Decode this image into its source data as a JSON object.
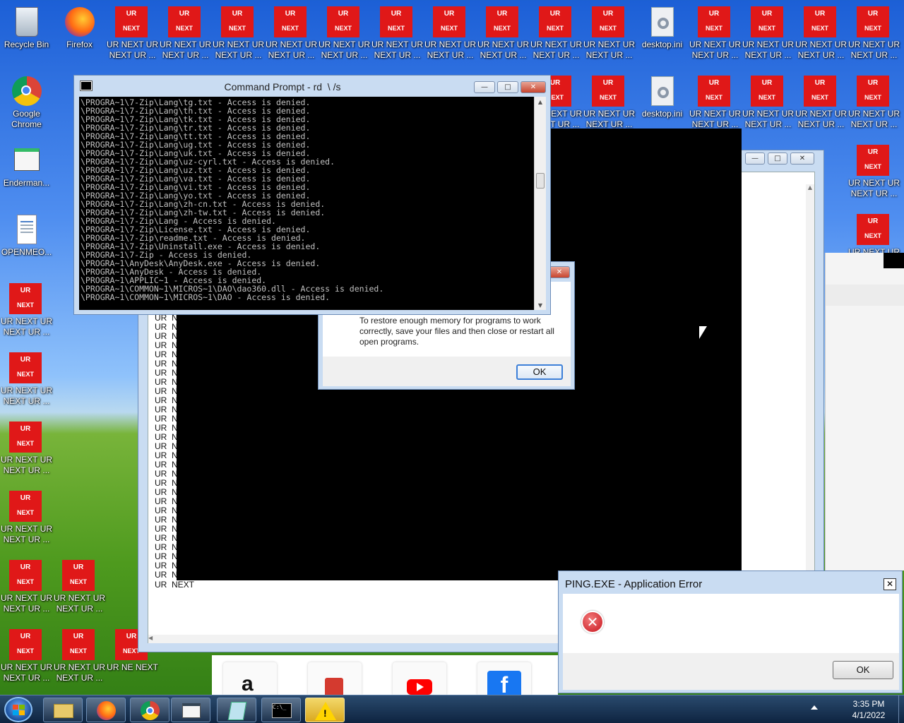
{
  "desktop": {
    "icons_row1": [
      {
        "label": "Recycle Bin",
        "kind": "recycle"
      },
      {
        "label": "Firefox",
        "kind": "firefox"
      },
      {
        "label": "UR NEXT UR NEXT UR ...",
        "kind": "ur"
      },
      {
        "label": "UR NEXT UR NEXT UR ...",
        "kind": "ur"
      },
      {
        "label": "UR NEXT UR NEXT UR ...",
        "kind": "ur"
      },
      {
        "label": "UR NEXT UR NEXT UR ...",
        "kind": "ur"
      },
      {
        "label": "UR NEXT UR NEXT UR ...",
        "kind": "ur"
      },
      {
        "label": "UR NEXT UR NEXT UR ...",
        "kind": "ur"
      },
      {
        "label": "UR NEXT UR NEXT UR ...",
        "kind": "ur"
      },
      {
        "label": "UR NEXT UR NEXT UR ...",
        "kind": "ur"
      },
      {
        "label": "UR NEXT UR NEXT UR ...",
        "kind": "ur"
      },
      {
        "label": "UR NEXT UR NEXT UR ...",
        "kind": "ur"
      },
      {
        "label": "desktop.ini",
        "kind": "ini"
      },
      {
        "label": "UR NEXT UR NEXT UR ...",
        "kind": "ur"
      },
      {
        "label": "UR NEXT UR NEXT UR ...",
        "kind": "ur"
      },
      {
        "label": "UR NEXT UR NEXT UR ...",
        "kind": "ur"
      },
      {
        "label": "UR NEXT UR NEXT UR ...",
        "kind": "ur"
      }
    ],
    "icons_row2": [
      {
        "label": "UR NEXT UR NEXT UR ...",
        "kind": "ur"
      },
      {
        "label": "UR NEXT UR NEXT UR ...",
        "kind": "ur"
      },
      {
        "label": "desktop.ini",
        "kind": "ini"
      },
      {
        "label": "UR NEXT UR NEXT UR ...",
        "kind": "ur"
      },
      {
        "label": "UR NEXT UR NEXT UR ...",
        "kind": "ur"
      },
      {
        "label": "UR NEXT UR NEXT UR ...",
        "kind": "ur"
      },
      {
        "label": "UR NEXT UR NEXT UR ...",
        "kind": "ur"
      }
    ],
    "icons_left": [
      {
        "label": "Google Chrome",
        "kind": "chrome"
      },
      {
        "label": "Enderman...",
        "kind": "app"
      },
      {
        "label": "OPENMEO...",
        "kind": "doc"
      },
      {
        "label": "UR NEXT UR NEXT UR ...",
        "kind": "ur"
      },
      {
        "label": "UR NEXT UR NEXT UR ...",
        "kind": "ur"
      },
      {
        "label": "UR NEXT UR NEXT UR ...",
        "kind": "ur"
      },
      {
        "label": "UR NEXT UR NEXT UR ...",
        "kind": "ur"
      },
      {
        "label": "UR NEXT UR NEXT UR ...",
        "kind": "ur"
      },
      {
        "label": "UR NEXT UR NEXT UR ...",
        "kind": "ur"
      }
    ],
    "icons_left_col2": [
      {
        "label": "UR NEXT UR NEXT UR ...",
        "kind": "ur"
      },
      {
        "label": "UR NEXT UR NEXT UR ...",
        "kind": "ur"
      },
      {
        "label": "UR NE NEXT",
        "kind": "ur"
      }
    ],
    "icons_right": [
      {
        "label": "UR NEXT UR NEXT UR ...",
        "kind": "ur"
      },
      {
        "label": "UR NEXT UR",
        "kind": "ur"
      }
    ],
    "tile_top": "UR",
    "tile_bottom": "NEXT"
  },
  "cmd": {
    "title": "Command Prompt - rd  \\ /s",
    "lines": [
      "\\PROGRA~1\\7-Zip\\Lang\\tg.txt - Access is denied.",
      "\\PROGRA~1\\7-Zip\\Lang\\th.txt - Access is denied.",
      "\\PROGRA~1\\7-Zip\\Lang\\tk.txt - Access is denied.",
      "\\PROGRA~1\\7-Zip\\Lang\\tr.txt - Access is denied.",
      "\\PROGRA~1\\7-Zip\\Lang\\tt.txt - Access is denied.",
      "\\PROGRA~1\\7-Zip\\Lang\\ug.txt - Access is denied.",
      "\\PROGRA~1\\7-Zip\\Lang\\uk.txt - Access is denied.",
      "\\PROGRA~1\\7-Zip\\Lang\\uz-cyrl.txt - Access is denied.",
      "\\PROGRA~1\\7-Zip\\Lang\\uz.txt - Access is denied.",
      "\\PROGRA~1\\7-Zip\\Lang\\va.txt - Access is denied.",
      "\\PROGRA~1\\7-Zip\\Lang\\vi.txt - Access is denied.",
      "\\PROGRA~1\\7-Zip\\Lang\\yo.txt - Access is denied.",
      "\\PROGRA~1\\7-Zip\\Lang\\zh-cn.txt - Access is denied.",
      "\\PROGRA~1\\7-Zip\\Lang\\zh-tw.txt - Access is denied.",
      "\\PROGRA~1\\7-Zip\\Lang - Access is denied.",
      "\\PROGRA~1\\7-Zip\\License.txt - Access is denied.",
      "\\PROGRA~1\\7-Zip\\readme.txt - Access is denied.",
      "\\PROGRA~1\\7-Zip\\Uninstall.exe - Access is denied.",
      "\\PROGRA~1\\7-Zip - Access is denied.",
      "\\PROGRA~1\\AnyDesk\\AnyDesk.exe - Access is denied.",
      "\\PROGRA~1\\AnyDesk - Access is denied.",
      "\\PROGRA~1\\APPLIC~1 - Access is denied.",
      "\\PROGRA~1\\COMMON~1\\MICROS~1\\DAO\\dao360.dll - Access is denied.",
      "\\PROGRA~1\\COMMON~1\\MICROS~1\\DAO - Access is denied."
    ]
  },
  "memory_dialog": {
    "message": "To restore enough memory for programs to work correctly, save your files and then close or restart all open programs.",
    "ok": "OK"
  },
  "notepad": {
    "line_prefix": "UR",
    "line_suffix": "N",
    "last_line": "UR  NEXT",
    "visible_rows": 29
  },
  "ping_error": {
    "title": "PING.EXE - Application Error",
    "ok": "OK"
  },
  "browser_shortcuts": [
    "amazon",
    "youtube",
    "facebook"
  ],
  "amazon_glyph": "a",
  "taskbar": {
    "clock_time": "3:35 PM",
    "clock_date": "4/1/2022",
    "apps": [
      "explorer",
      "firefox",
      "chrome",
      "app",
      "notepad",
      "cmd",
      "warning"
    ]
  },
  "colors": {
    "tile_red": "#e01818",
    "console_bg": "#000000",
    "error_red": "#d9262c"
  }
}
